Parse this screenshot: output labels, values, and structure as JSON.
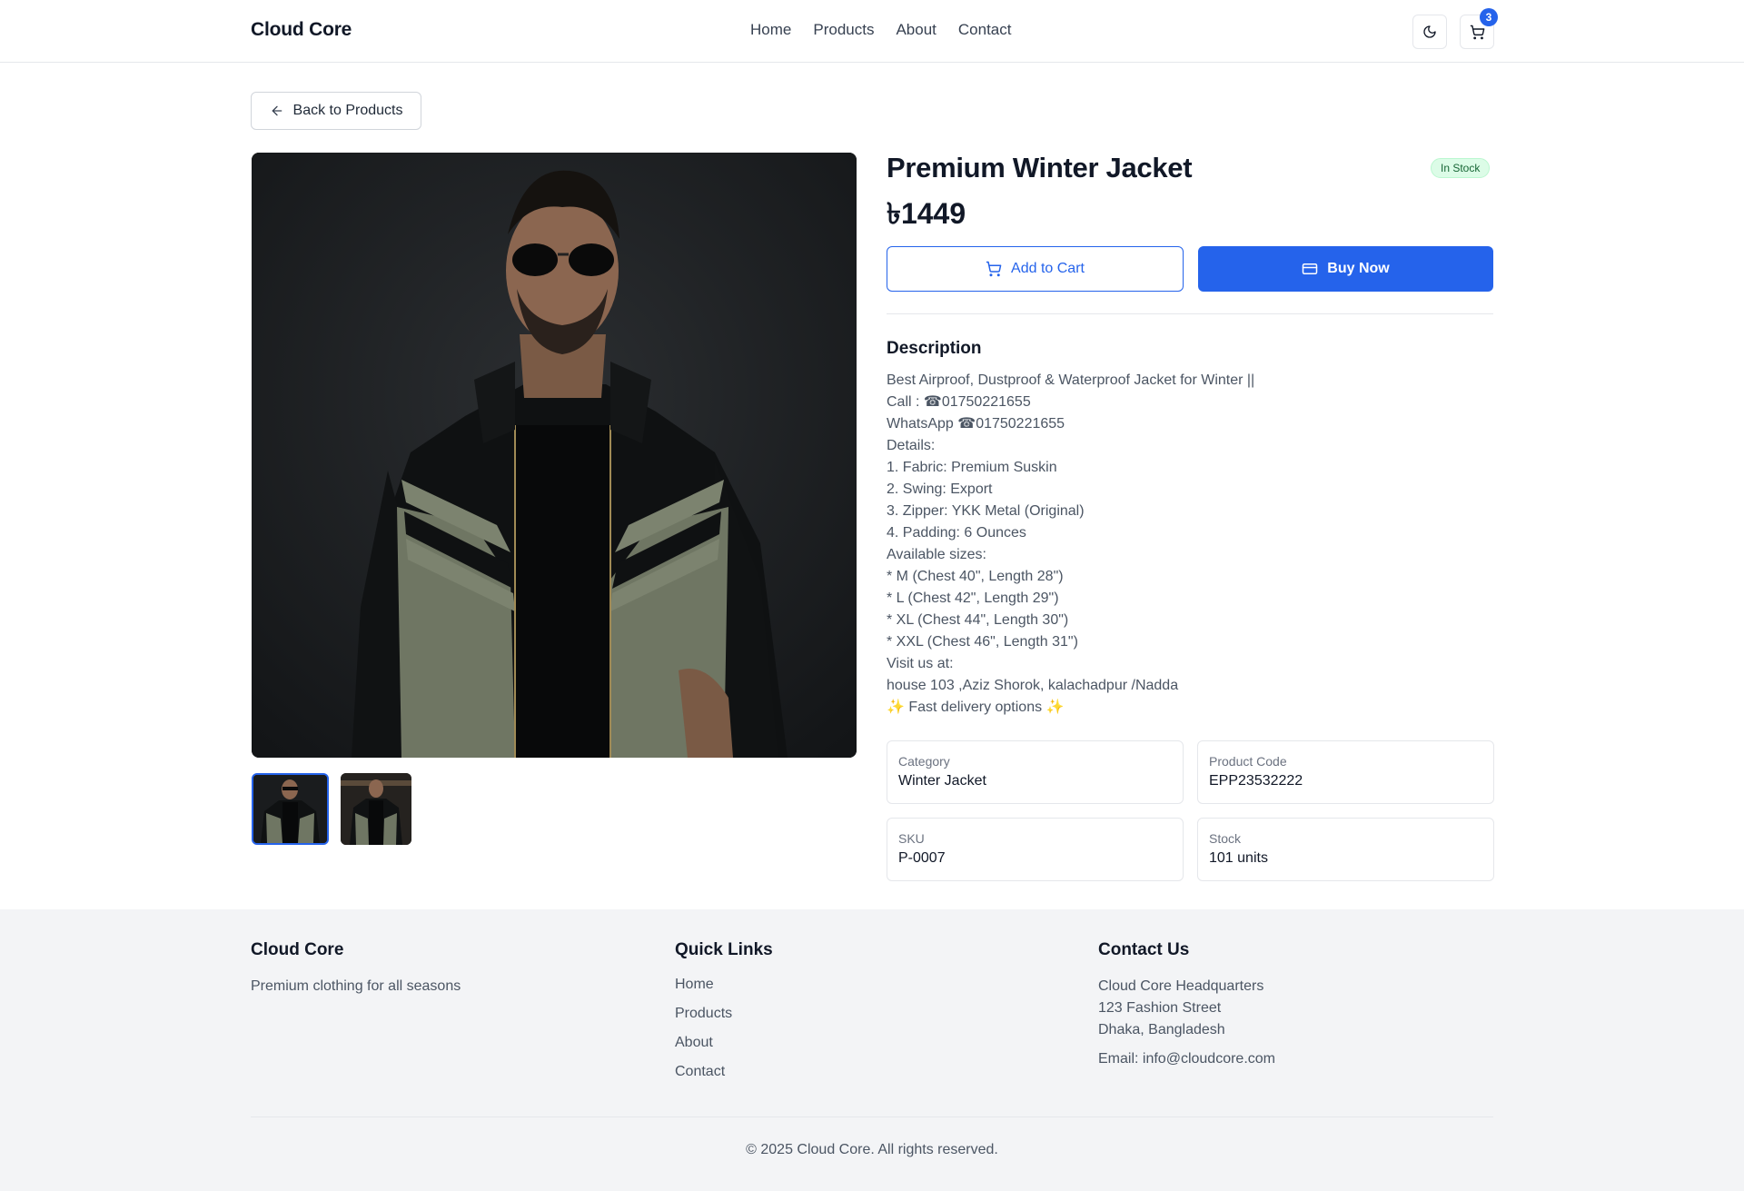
{
  "header": {
    "brand": "Cloud Core",
    "nav": [
      "Home",
      "Products",
      "About",
      "Contact"
    ],
    "cart_count": "3"
  },
  "back_label": "Back to Products",
  "product": {
    "title": "Premium Winter Jacket",
    "stock_status": "In Stock",
    "price": "৳1449",
    "add_to_cart_label": "Add to Cart",
    "buy_now_label": "Buy Now",
    "description_heading": "Description",
    "description_lines": [
      "Best Airproof, Dustproof & Waterproof Jacket for Winter ||",
      "Call : ☎01750221655",
      "WhatsApp ☎01750221655",
      "Details:",
      "1. Fabric: Premium Suskin",
      "2. Swing: Export",
      "3. Zipper: YKK Metal (Original)",
      "4. Padding: 6 Ounces",
      "Available sizes:",
      "* M (Chest 40\", Length 28\")",
      "* L (Chest 42\", Length 29\")",
      "* XL (Chest 44\", Length 30\")",
      "* XXL (Chest 46\", Length 31\")",
      "Visit us at:",
      "house 103 ,Aziz Shorok, kalachadpur /Nadda",
      "✨ Fast delivery options ✨"
    ],
    "info": [
      {
        "label": "Category",
        "value": "Winter Jacket"
      },
      {
        "label": "Product Code",
        "value": "EPP23532222"
      },
      {
        "label": "SKU",
        "value": "P-0007"
      },
      {
        "label": "Stock",
        "value": "101 units"
      }
    ]
  },
  "colors": {
    "accent": "#2563eb",
    "stock_badge_bg": "#dcfce7",
    "stock_badge_text": "#166534",
    "footer_bg": "#f3f4f6"
  },
  "icons": {
    "theme": "moon-icon",
    "cart": "cart-icon",
    "back": "arrow-left-icon",
    "buy": "credit-card-icon"
  },
  "footer": {
    "brand_heading": "Cloud Core",
    "tagline": "Premium clothing for all seasons",
    "links_heading": "Quick Links",
    "links": [
      "Home",
      "Products",
      "About",
      "Contact"
    ],
    "contact_heading": "Contact Us",
    "address_lines": [
      "Cloud Core Headquarters",
      "123 Fashion Street",
      "Dhaka, Bangladesh"
    ],
    "email": "Email: info@cloudcore.com",
    "copyright": "© 2025 Cloud Core. All rights reserved."
  }
}
